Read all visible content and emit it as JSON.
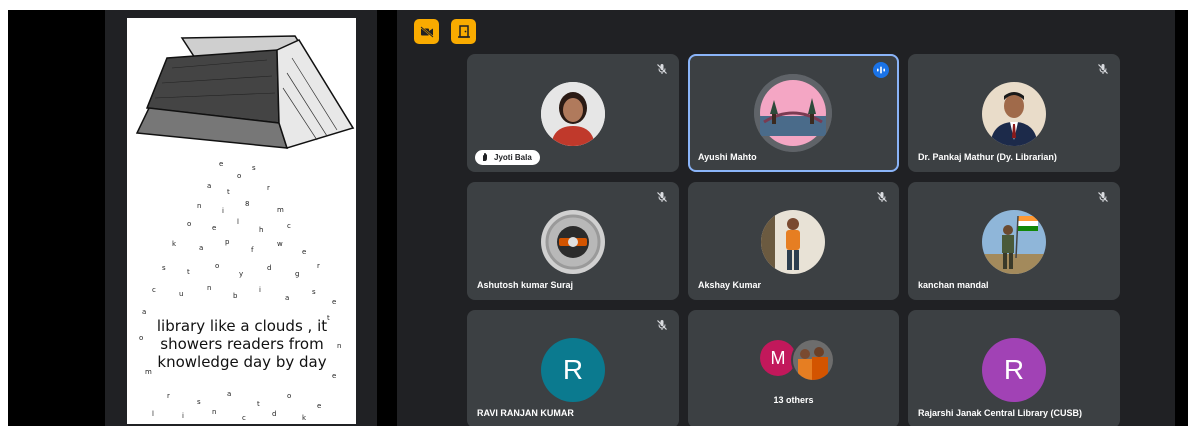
{
  "slide": {
    "lines": [
      "library like a clouds , it",
      "showers readers from",
      "knowledge day by day"
    ]
  },
  "toolbar": {
    "camera_off_icon": "video-off-icon",
    "exit_icon": "door-exit-icon",
    "accent": "#f9ab00"
  },
  "participants": [
    {
      "name": "Jyoti Bala",
      "muted": true,
      "style": "pill",
      "avatar": "photo-woman"
    },
    {
      "name": "Ayushi Mahto",
      "muted": false,
      "speaking": true,
      "avatar": "photo-bridge"
    },
    {
      "name": "Dr. Pankaj Mathur (Dy. Librarian)",
      "muted": true,
      "avatar": "photo-man-suit"
    },
    {
      "name": "Ashutosh kumar Suraj",
      "muted": true,
      "avatar": "photo-badge"
    },
    {
      "name": "Akshay Kumar",
      "muted": true,
      "avatar": "photo-man-orange"
    },
    {
      "name": "kanchan mandal",
      "muted": true,
      "avatar": "photo-man-flag"
    },
    {
      "name": "RAVI RANJAN KUMAR",
      "muted": true,
      "initial": "R",
      "color": "#0b7a8f"
    },
    {
      "name": "13 others",
      "others": true,
      "initial": "M",
      "color": "#c2185b"
    },
    {
      "name": "Rajarshi Janak Central Library (CUSB)",
      "muted": false,
      "initial": "R",
      "color": "#a142b5"
    }
  ],
  "colors": {
    "background": "#202124",
    "tile": "#3c4043",
    "speaking_border": "#8ab4f8",
    "speaking_indicator": "#1a73e8"
  }
}
